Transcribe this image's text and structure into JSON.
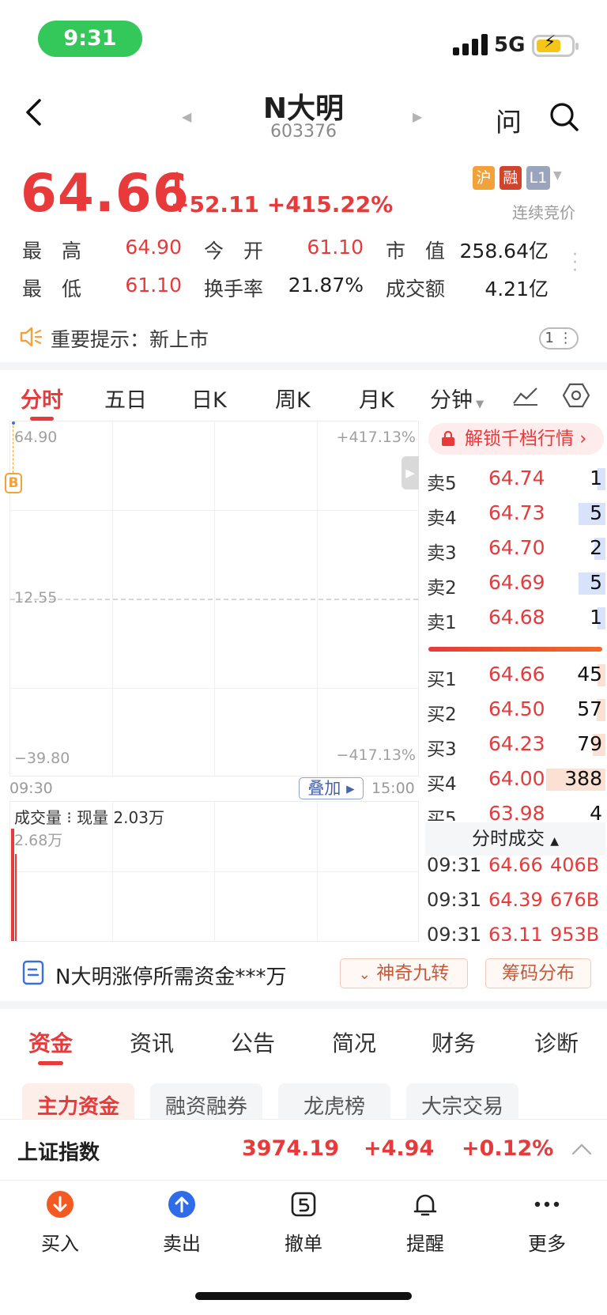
{
  "status": {
    "time": "9:31",
    "network": "5G"
  },
  "header": {
    "title": "N大明",
    "code": "603376",
    "ask_label": "问"
  },
  "quote": {
    "price": "64.66",
    "change": "+52.11",
    "change_pct": "+415.22%",
    "badges": [
      "沪",
      "融",
      "L1"
    ],
    "badge_colors": [
      "#f2a23a",
      "#d2432c",
      "#9aa4bd"
    ],
    "mode": "连续竞价"
  },
  "stats": {
    "high_label": "最　高",
    "high": "64.90",
    "open_label": "今　开",
    "open": "61.10",
    "mcap_label": "市　值",
    "mcap": "258.64亿",
    "low_label": "最　低",
    "low": "61.10",
    "turnover_label": "换手率",
    "turnover": "21.87%",
    "amount_label": "成交额",
    "amount": "4.21亿"
  },
  "notice": {
    "text": "重要提示：新上市",
    "count": "1"
  },
  "chart_tabs": [
    "分时",
    "五日",
    "日K",
    "周K",
    "月K",
    "分钟"
  ],
  "chart": {
    "y_top": "64.90",
    "y_mid": "12.55",
    "y_bottom": "−39.80",
    "pct_top": "+417.13%",
    "pct_bottom": "−417.13%",
    "time_start": "09:30",
    "time_end": "15:00",
    "overlay_label": "叠加",
    "marker": "B",
    "volume_title": "成交量",
    "volume_current": "现量 2.03万",
    "volume_max": "2.68万"
  },
  "orderbook": {
    "unlock_label": "解锁千档行情",
    "asks": [
      {
        "label": "卖5",
        "price": "64.74",
        "qty": "1",
        "fill": 0.03
      },
      {
        "label": "卖4",
        "price": "64.73",
        "qty": "5",
        "fill": 0.15
      },
      {
        "label": "卖3",
        "price": "64.70",
        "qty": "2",
        "fill": 0.06
      },
      {
        "label": "卖2",
        "price": "64.69",
        "qty": "5",
        "fill": 0.15
      },
      {
        "label": "卖1",
        "price": "64.68",
        "qty": "1",
        "fill": 0.03
      }
    ],
    "bids": [
      {
        "label": "买1",
        "price": "64.66",
        "qty": "45",
        "fill": 0.04
      },
      {
        "label": "买2",
        "price": "64.50",
        "qty": "57",
        "fill": 0.05
      },
      {
        "label": "买3",
        "price": "64.23",
        "qty": "79",
        "fill": 0.07
      },
      {
        "label": "买4",
        "price": "64.00",
        "qty": "388",
        "fill": 0.33
      },
      {
        "label": "买5",
        "price": "63.98",
        "qty": "4",
        "fill": 0.0
      }
    ],
    "ticks_label": "分时成交",
    "ticks": [
      {
        "time": "09:31",
        "price": "64.66",
        "vol": "406B"
      },
      {
        "time": "09:31",
        "price": "64.39",
        "vol": "676B"
      },
      {
        "time": "09:31",
        "price": "63.11",
        "vol": "953B"
      }
    ]
  },
  "promo": {
    "text": "N大明涨停所需资金***万",
    "btn1": "神奇九转",
    "btn2": "筹码分布"
  },
  "lower_tabs": [
    "资金",
    "资讯",
    "公告",
    "简况",
    "财务",
    "诊断"
  ],
  "chips": [
    "主力资金",
    "融资融券",
    "龙虎榜",
    "大宗交易"
  ],
  "index": {
    "name": "上证指数",
    "value": "3974.19",
    "change": "+4.94",
    "pct": "+0.12%"
  },
  "nav": [
    "买入",
    "卖出",
    "撤单",
    "提醒",
    "更多"
  ]
}
